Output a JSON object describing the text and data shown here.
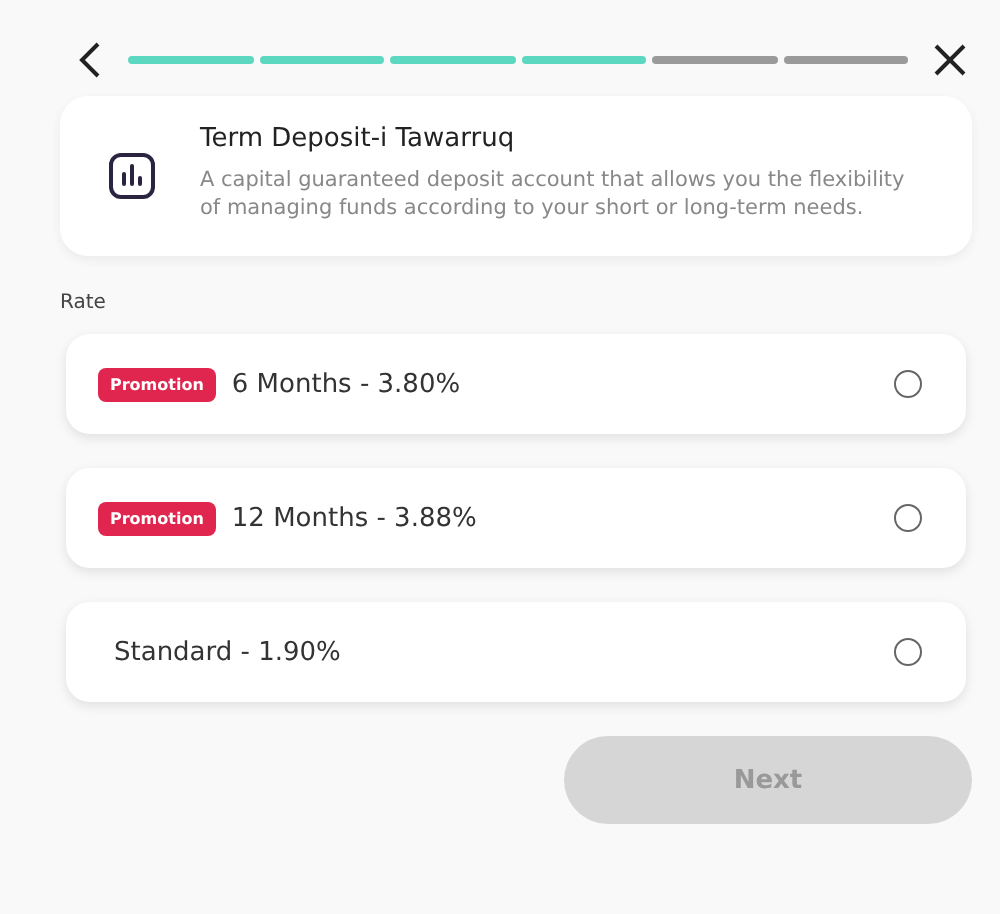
{
  "progress_steps": [
    {
      "done": true
    },
    {
      "done": true
    },
    {
      "done": true
    },
    {
      "done": true
    },
    {
      "done": false
    },
    {
      "done": false
    }
  ],
  "product": {
    "title": "Term Deposit-i Tawarruq",
    "description": "A capital guaranteed deposit account that allows you the flexibility of managing funds according to your short or long-term needs."
  },
  "rate_label": "Rate",
  "options": [
    {
      "badge": "Promotion",
      "label": "6 Months - 3.80%",
      "selected": false
    },
    {
      "badge": "Promotion",
      "label": "12 Months - 3.88%",
      "selected": false
    },
    {
      "label": "Standard - 1.90%",
      "selected": false
    }
  ],
  "next_button": {
    "label": "Next",
    "disabled": true
  }
}
